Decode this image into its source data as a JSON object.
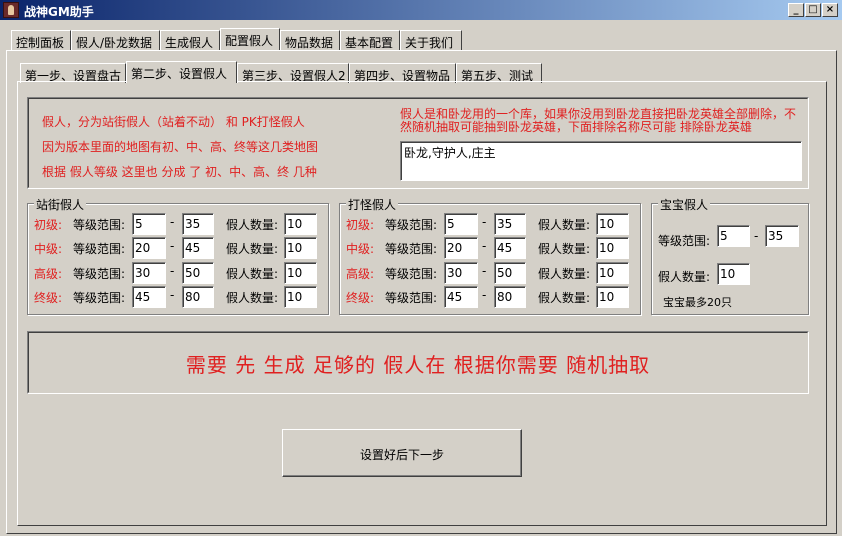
{
  "window": {
    "title": "战神GM助手",
    "min": "_",
    "max": "□",
    "close": "×"
  },
  "main_tabs": [
    "控制面板",
    "假人/卧龙数据",
    "生成假人",
    "配置假人",
    "物品数据",
    "基本配置",
    "关于我们"
  ],
  "sub_tabs": [
    "第一步、设置盘古",
    "第二步、设置假人",
    "第三步、设置假人2",
    "第四步、设置物品",
    "第五步、测试"
  ],
  "info": {
    "line1": "假人，分为站街假人（站着不动） 和 PK打怪假人",
    "line2": "因为版本里面的地图有初、中、高、终等这几类地图",
    "line3": "根据 假人等级 这里也 分成 了 初、中、高、终 几种",
    "wolong_note": "假人是和卧龙用的一个库，如果你没用到卧龙直接把卧龙英雄全部删除，不然随机抽取可能抽到卧龙英雄，下面排除名称尽可能 排除卧龙英雄",
    "exclude_names": "卧龙,守护人,庄主"
  },
  "labels": {
    "level_range": "等级范围:",
    "count": "假人数量:",
    "dash": "-"
  },
  "standing": {
    "title": "站街假人",
    "rows": [
      {
        "tier": "初级:",
        "min": "5",
        "max": "35",
        "count": "10"
      },
      {
        "tier": "中级:",
        "min": "20",
        "max": "45",
        "count": "10"
      },
      {
        "tier": "高级:",
        "min": "30",
        "max": "50",
        "count": "10"
      },
      {
        "tier": "终级:",
        "min": "45",
        "max": "80",
        "count": "10"
      }
    ]
  },
  "fighting": {
    "title": "打怪假人",
    "rows": [
      {
        "tier": "初级:",
        "min": "5",
        "max": "35",
        "count": "10"
      },
      {
        "tier": "中级:",
        "min": "20",
        "max": "45",
        "count": "10"
      },
      {
        "tier": "高级:",
        "min": "30",
        "max": "50",
        "count": "10"
      },
      {
        "tier": "终级:",
        "min": "45",
        "max": "80",
        "count": "10"
      }
    ]
  },
  "pet": {
    "title": "宝宝假人",
    "level_label": "等级范围:",
    "min": "5",
    "max": "35",
    "count_label": "假人数量:",
    "count": "10",
    "note": "宝宝最多20只"
  },
  "banner": "需要 先 生成 足够的 假人在 根据你需要 随机抽取",
  "next_button": "设置好后下一步",
  "colors": {
    "accent_red": "#e02020",
    "title_bar": "#0a246a"
  }
}
